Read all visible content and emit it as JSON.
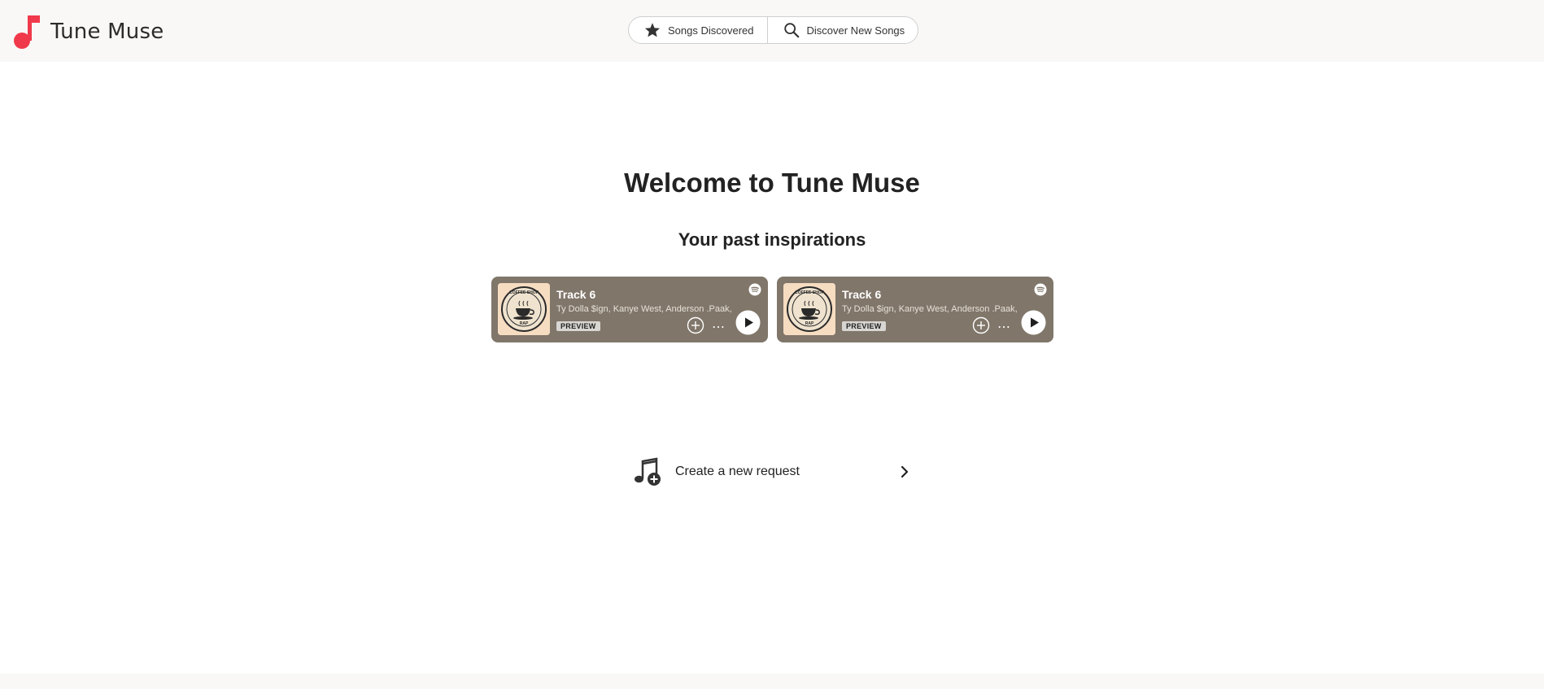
{
  "app": {
    "name": "Tune Muse",
    "logo_icon": "music-note-icon",
    "brand_color": "#f0394a"
  },
  "nav": {
    "songs_discovered": {
      "label": "Songs Discovered",
      "icon": "star-icon"
    },
    "discover_new": {
      "label": "Discover New Songs",
      "icon": "search-icon"
    }
  },
  "main": {
    "title": "Welcome to Tune Muse",
    "past_inspirations_title": "Your past inspirations",
    "cards": [
      {
        "title": "Track 6",
        "artists": "Ty Dolla $ign, Kanye West, Anderson .Paak,",
        "badge": "PREVIEW",
        "art_text_top": "COFFEE SHOP",
        "art_text_bottom": "RAP",
        "service_icon": "spotify-icon",
        "card_color": "#80766a"
      },
      {
        "title": "Track 6",
        "artists": "Ty Dolla $ign, Kanye West, Anderson .Paak,",
        "badge": "PREVIEW",
        "art_text_top": "COFFEE SHOP",
        "art_text_bottom": "RAP",
        "service_icon": "spotify-icon",
        "card_color": "#80766a"
      }
    ],
    "request": {
      "label": "Create a new request",
      "icon": "music-add-icon",
      "chevron": "chevron-right-icon"
    }
  }
}
